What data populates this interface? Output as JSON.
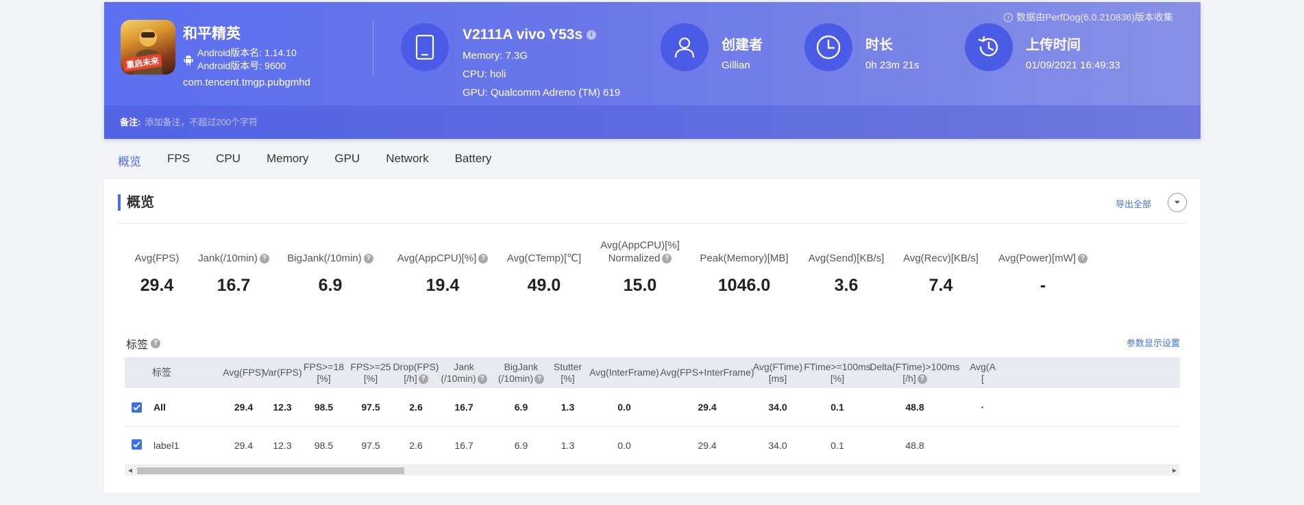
{
  "header": {
    "notice": "数据由PerfDog(6.0.210836)版本收集",
    "app": {
      "name": "和平精英",
      "badge": "重启未来",
      "android_version_name": "Android版本名: 1.14.10",
      "android_version_code": "Android版本号: 9600",
      "package": "com.tencent.tmgp.pubgmhd"
    },
    "device": {
      "name": "V2111A vivo Y53s",
      "memory": "Memory: 7.3G",
      "cpu": "CPU: holi",
      "gpu": "GPU: Qualcomm Adreno (TM) 619"
    },
    "creator": {
      "title": "创建者",
      "value": "Gillian"
    },
    "duration": {
      "title": "时长",
      "value": "0h 23m 21s"
    },
    "upload": {
      "title": "上传时间",
      "value": "01/09/2021 16:49:33"
    },
    "remark": {
      "label": "备注:",
      "placeholder": "添加备注，不超过200个字符"
    }
  },
  "tabs": [
    "概览",
    "FPS",
    "CPU",
    "Memory",
    "GPU",
    "Network",
    "Battery"
  ],
  "overview": {
    "title": "概览",
    "export_label": "导出全部",
    "stats": [
      {
        "label": "Avg(FPS)",
        "value": "29.4",
        "help": false
      },
      {
        "label": "Jank(/10min)",
        "value": "16.7",
        "help": true
      },
      {
        "label": "BigJank(/10min)",
        "value": "6.9",
        "help": true
      },
      {
        "label": "Avg(AppCPU)[%]",
        "value": "19.4",
        "help": true
      },
      {
        "label": "Avg(CTemp)[℃]",
        "value": "49.0",
        "help": false
      },
      {
        "label": "Avg(AppCPU)[%]",
        "label2": "Normalized",
        "value": "15.0",
        "help": true
      },
      {
        "label": "Peak(Memory)[MB]",
        "value": "1046.0",
        "help": false
      },
      {
        "label": "Avg(Send)[KB/s]",
        "value": "3.6",
        "help": false
      },
      {
        "label": "Avg(Recv)[KB/s]",
        "value": "7.4",
        "help": false
      },
      {
        "label": "Avg(Power)[mW]",
        "value": "-",
        "help": true
      }
    ]
  },
  "tags": {
    "title": "标签",
    "param_link": "参数显示设置",
    "columns": [
      {
        "l1": "标签",
        "l2": "",
        "help": false
      },
      {
        "l1": "Avg(FPS)",
        "l2": "",
        "help": false
      },
      {
        "l1": "Var(FPS)",
        "l2": "",
        "help": false
      },
      {
        "l1": "FPS>=18",
        "l2": "[%]",
        "help": false
      },
      {
        "l1": "FPS>=25",
        "l2": "[%]",
        "help": false
      },
      {
        "l1": "Drop(FPS)",
        "l2": "[/h]",
        "help": true
      },
      {
        "l1": "Jank",
        "l2": "(/10min)",
        "help": true
      },
      {
        "l1": "BigJank",
        "l2": "(/10min)",
        "help": true
      },
      {
        "l1": "Stutter",
        "l2": "[%]",
        "help": false
      },
      {
        "l1": "Avg(InterFrame)",
        "l2": "",
        "help": false
      },
      {
        "l1": "Avg(FPS+InterFrame)",
        "l2": "",
        "help": false
      },
      {
        "l1": "Avg(FTime)",
        "l2": "[ms]",
        "help": false
      },
      {
        "l1": "FTime>=100ms",
        "l2": "[%]",
        "help": false
      },
      {
        "l1": "Delta(FTime)>100ms",
        "l2": "[/h]",
        "help": true
      },
      {
        "l1": "Avg(A",
        "l2": "[",
        "help": false
      }
    ],
    "rows": [
      {
        "label": "All",
        "checked": true,
        "values": [
          "29.4",
          "12.3",
          "98.5",
          "97.5",
          "2.6",
          "16.7",
          "6.9",
          "1.3",
          "0.0",
          "29.4",
          "34.0",
          "0.1",
          "48.8",
          "·"
        ]
      },
      {
        "label": "label1",
        "checked": true,
        "values": [
          "29.4",
          "12.3",
          "98.5",
          "97.5",
          "2.6",
          "16.7",
          "6.9",
          "1.3",
          "0.0",
          "29.4",
          "34.0",
          "0.1",
          "48.8",
          ""
        ]
      }
    ]
  },
  "colors": {
    "accent": "#4a6cf0",
    "header_start": "#5b6ff0",
    "header_end": "#8890e6",
    "link": "#3d6fe8"
  }
}
